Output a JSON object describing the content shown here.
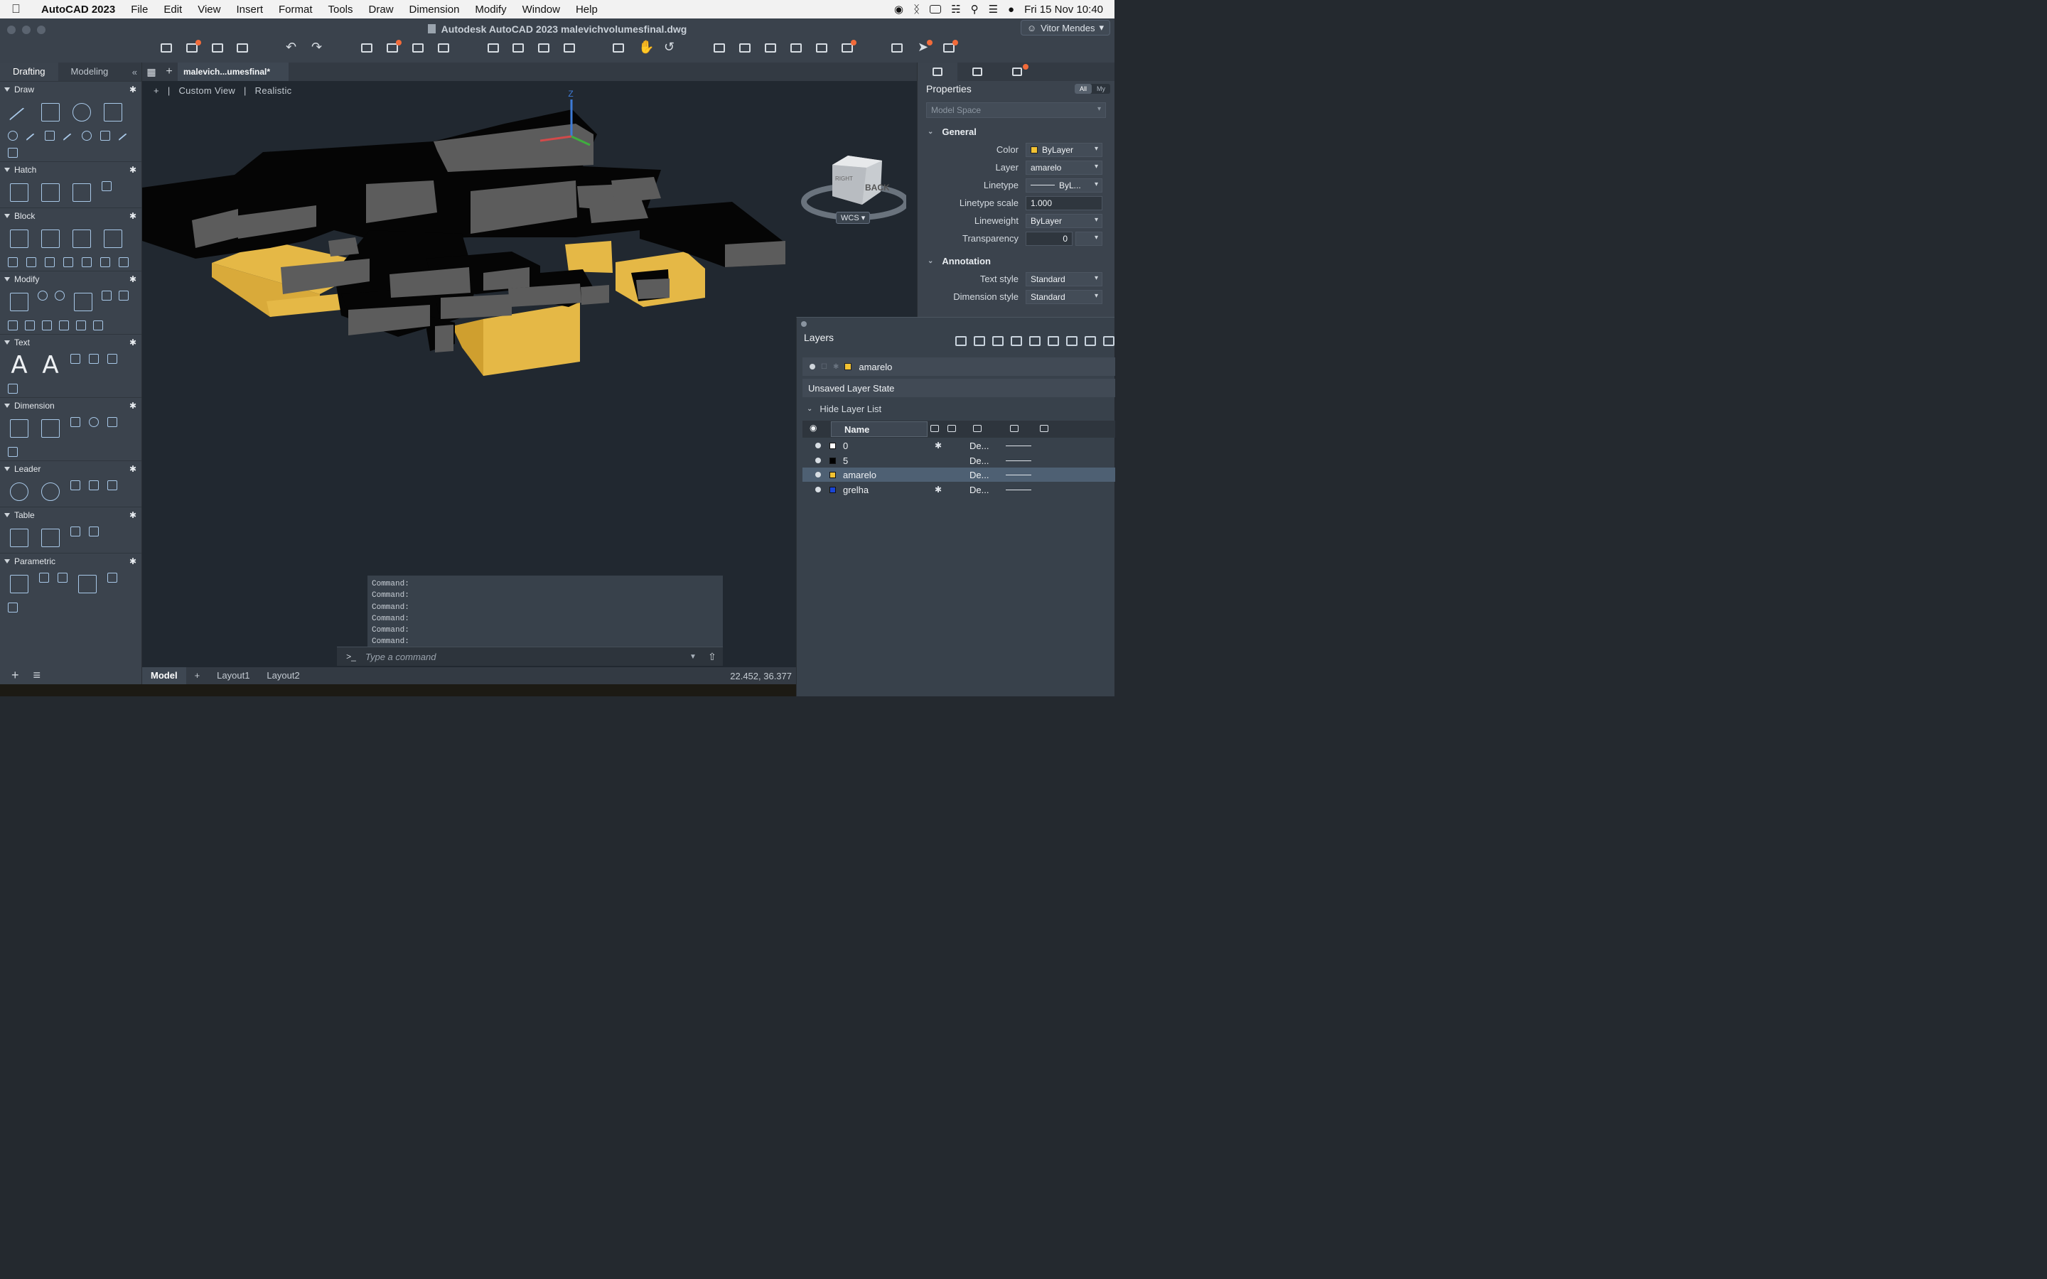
{
  "menubar": {
    "app": "AutoCAD 2023",
    "items": [
      "File",
      "Edit",
      "View",
      "Insert",
      "Format",
      "Tools",
      "Draw",
      "Dimension",
      "Modify",
      "Window",
      "Help"
    ],
    "datetime": "Fri 15 Nov  10:40"
  },
  "window": {
    "title": "Autodesk AutoCAD 2023    malevichvolumesfinal.dwg",
    "user": "Vitor Mendes"
  },
  "palette": {
    "tabs": [
      "Drafting",
      "Modeling"
    ],
    "active_tab": "Drafting",
    "sections": [
      "Draw",
      "Hatch",
      "Block",
      "Modify",
      "Text",
      "Dimension",
      "Leader",
      "Table",
      "Parametric"
    ]
  },
  "file_tab": "malevich...umesfinal*",
  "viewport": {
    "view": "Custom View",
    "style": "Realistic",
    "wcs": "WCS",
    "cube_faces": [
      "RIGHT",
      "BACK"
    ]
  },
  "command": {
    "history": [
      "Command:",
      "Command:",
      "Command:",
      "Command:",
      "Command:",
      "Command:"
    ],
    "placeholder": "Type a command",
    "prompt": ">_"
  },
  "status": {
    "layouts": [
      "Model",
      "Layout1",
      "Layout2"
    ],
    "coords": "22.452,  36.377"
  },
  "properties": {
    "title": "Properties",
    "toggle": [
      "All",
      "My"
    ],
    "selection": "Model Space",
    "general_label": "General",
    "general": [
      {
        "label": "Color",
        "value": "ByLayer"
      },
      {
        "label": "Layer",
        "value": "amarelo"
      },
      {
        "label": "Linetype",
        "value": "ByL..."
      },
      {
        "label": "Linetype scale",
        "value": "1.000"
      },
      {
        "label": "Lineweight",
        "value": "ByLayer"
      },
      {
        "label": "Transparency",
        "value": "0"
      }
    ],
    "annotation_label": "Annotation",
    "annotation": [
      {
        "label": "Text style",
        "value": "Standard"
      },
      {
        "label": "Dimension style",
        "value": "Standard"
      }
    ],
    "color_swatch": "#f2c232"
  },
  "layers": {
    "title": "Layers",
    "current": "amarelo",
    "state": "Unsaved Layer State",
    "hide_list": "Hide Layer List",
    "name_header": "Name",
    "rows": [
      {
        "name": "0",
        "color": "#ffffff",
        "lt": "De...",
        "freeze": true
      },
      {
        "name": "5",
        "color": "#000000",
        "lt": "De...",
        "freeze": false
      },
      {
        "name": "amarelo",
        "color": "#f2c232",
        "lt": "De...",
        "freeze": false,
        "selected": true
      },
      {
        "name": "grelha",
        "color": "#1a45d6",
        "lt": "De...",
        "freeze": true
      }
    ]
  },
  "colors": {
    "accent_badge": "#f26b3a",
    "yellow_volume": "#e5b846",
    "gray_volume": "#5c5c5c"
  }
}
